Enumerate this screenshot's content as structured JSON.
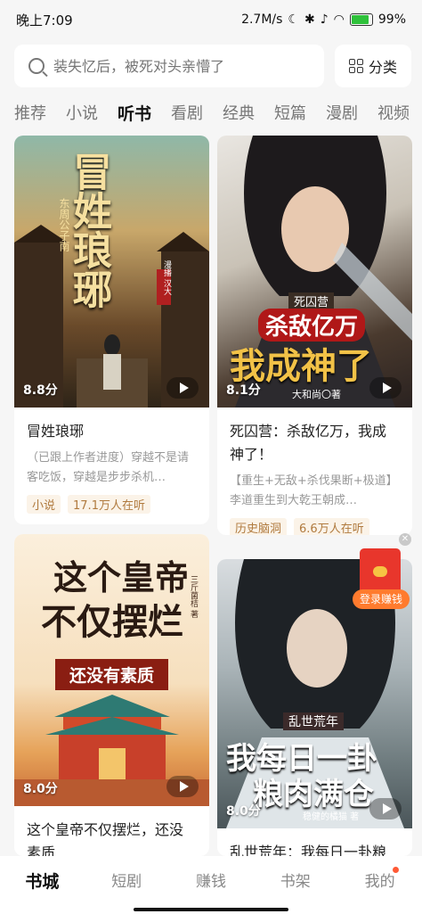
{
  "status_bar": {
    "time": "晚上7:09",
    "speed": "2.7M/s",
    "battery": "99%"
  },
  "search": {
    "placeholder": "装失忆后，被死对头亲懵了",
    "category_label": "分类"
  },
  "tabs": [
    "推荐",
    "小说",
    "听书",
    "看剧",
    "经典",
    "短篇",
    "漫剧",
    "视频"
  ],
  "active_tab": 2,
  "cards": [
    {
      "title": "冒姓琅琊",
      "score": "8.8分",
      "desc": "（已跟上作者进度）穿越不是请客吃饭，穿越是步步杀机…",
      "tags": [
        "小说",
        "17.1万人在听"
      ],
      "cover": {
        "title": "冒姓琅琊",
        "author": "东周公子南",
        "badge": "漫播 汉大"
      }
    },
    {
      "title": "死囚营：杀敌亿万，我成神了！",
      "score": "8.1分",
      "desc": "【重生+无敌+杀伐果断+极道】李道重生到大乾王朝成…",
      "tags": [
        "历史脑洞",
        "6.6万人在听"
      ],
      "cover": {
        "subtitle": "死囚营",
        "line1": "杀敌亿万",
        "line2": "我成神了",
        "author": "大和尚〇著"
      }
    },
    {
      "title": "这个皇帝不仅摆烂，还没素质",
      "score": "8.0分",
      "cover": {
        "line1": "这个皇帝",
        "line2": "不仅摆烂",
        "line3": "还没有素质",
        "author": "三斤菌桔 著"
      }
    },
    {
      "title": "乱世荒年：我每日一卦粮肉满仓！",
      "score": "8.0分",
      "cover": {
        "subtitle": "乱世荒年",
        "line1": "我每日一卦",
        "line2": "粮肉满仓",
        "author": "稳健的橘猫 著"
      }
    }
  ],
  "promo": {
    "login_earn": "登录赚钱"
  },
  "bottom_nav": [
    "书城",
    "短剧",
    "赚钱",
    "书架",
    "我的"
  ],
  "colors": {
    "accent": "#b07a3e",
    "tag_bg": "#fbf3e8",
    "nav_dot": "#ff5a36",
    "promo": "#ff7b2e"
  }
}
